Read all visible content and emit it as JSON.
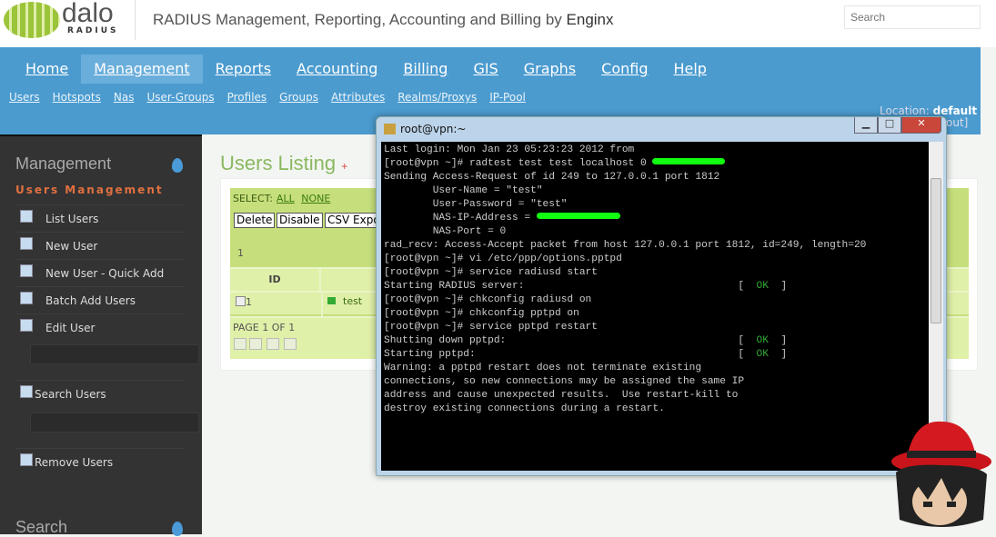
{
  "header": {
    "logo_text": "daloRADIUS",
    "logo_main": "dalo",
    "logo_sub": "RADIUS",
    "tagline": "RADIUS Management, Reporting, Accounting and Billing by ",
    "tagline_brand": "Enginx",
    "search_placeholder": "Search"
  },
  "nav": {
    "main": [
      "Home",
      "Management",
      "Reports",
      "Accounting",
      "Billing",
      "GIS",
      "Graphs",
      "Config",
      "Help"
    ],
    "active": "Management",
    "sub": [
      "Users",
      "Hotspots",
      "Nas",
      "User-Groups",
      "Profiles",
      "Groups",
      "Attributes",
      "Realms/Proxys",
      "IP-Pool"
    ],
    "location_label": "Location:",
    "location_value": "default",
    "logout_partial": "out]"
  },
  "sidebar": {
    "heading": "Management",
    "subheading": "Users Management",
    "items": [
      "List Users",
      "New User",
      "New User - Quick Add",
      "Batch Add Users",
      "Edit User"
    ],
    "search_users": "Search Users",
    "remove_users": "Remove Users",
    "next_heading": "Search"
  },
  "content": {
    "title": "Users Listing",
    "title_plus": "+",
    "select_label": "SELECT:",
    "select_all": "ALL",
    "select_none": "NONE",
    "buttons": [
      "Delete",
      "Disable",
      "CSV Expo"
    ],
    "count": "1",
    "col_id": "ID",
    "row_id": "1",
    "row_user": "test",
    "pager": "PAGE 1 OF 1"
  },
  "terminal": {
    "title": "root@vpn:~",
    "lines": [
      "Last login: Mon Jan 23 05:23:23 2012 from",
      "[root@vpn ~]# radtest test test localhost 0 ",
      "Sending Access-Request of id 249 to 127.0.0.1 port 1812",
      "        User-Name = \"test\"",
      "        User-Password = \"test\"",
      "        NAS-IP-Address = ",
      "        NAS-Port = 0",
      "rad_recv: Access-Accept packet from host 127.0.0.1 port 1812, id=249, length=20",
      "[root@vpn ~]# vi /etc/ppp/options.pptpd",
      "[root@vpn ~]# service radiusd start",
      "Starting RADIUS server:                                   [  OK  ]",
      "[root@vpn ~]# chkconfig radiusd on",
      "[root@vpn ~]# chkconfig pptpd on",
      "[root@vpn ~]# service pptpd restart",
      "Shutting down pptpd:                                      [  OK  ]",
      "Starting pptpd:                                           [  OK  ]",
      "Warning: a pptpd restart does not terminate existing",
      "connections, so new connections may be assigned the same IP",
      "address and cause unexpected results.  Use restart-kill to",
      "destroy existing connections during a restart."
    ],
    "redacted_lines": [
      1,
      5
    ]
  },
  "colors": {
    "nav": "#4b9bcf",
    "sidebar": "#333333",
    "accent_green": "#8ab860",
    "panel_green": "#c6df7c",
    "terminal_bg": "#000000",
    "ok": "#33aa33",
    "redaction": "#11ff11"
  }
}
